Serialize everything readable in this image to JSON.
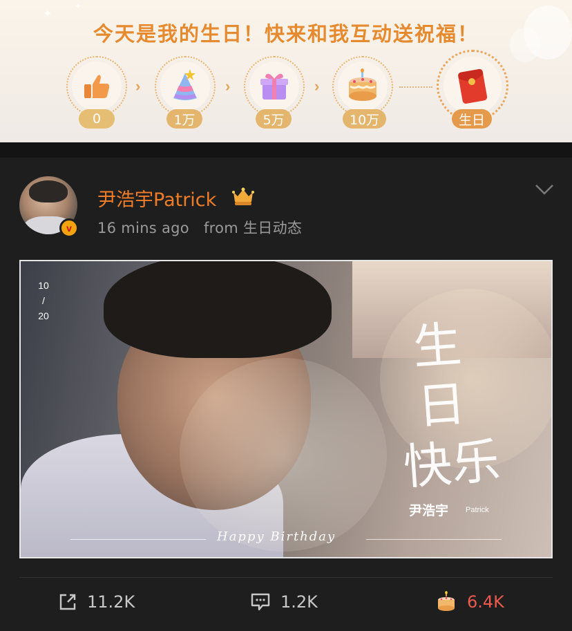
{
  "banner": {
    "title": "今天是我的生日！快来和我互动送祝福！",
    "milestones": [
      {
        "label": "0",
        "icon": "thumbs-up-icon"
      },
      {
        "label": "1万",
        "icon": "party-hat-icon"
      },
      {
        "label": "5万",
        "icon": "gift-box-icon"
      },
      {
        "label": "10万",
        "icon": "birthday-cake-icon"
      },
      {
        "label": "生日",
        "icon": "red-envelope-icon"
      }
    ]
  },
  "post": {
    "username": "尹浩宇Patrick",
    "time": "16 mins ago",
    "source": "from 生日动态",
    "image": {
      "date_month": "10",
      "date_sep": "/",
      "date_day": "20",
      "headline_line1": "生日",
      "headline_line2": "快乐",
      "signature_cn": "尹浩宇",
      "signature_en": "Patrick",
      "tagline": "Happy Birthday"
    },
    "actions": {
      "repost": "11.2K",
      "comment": "1.2K",
      "like": "6.4K"
    }
  },
  "colors": {
    "accent_orange": "#f07d2a",
    "like_red": "#ea5a4e",
    "banner_gold": "#e3b56d"
  }
}
